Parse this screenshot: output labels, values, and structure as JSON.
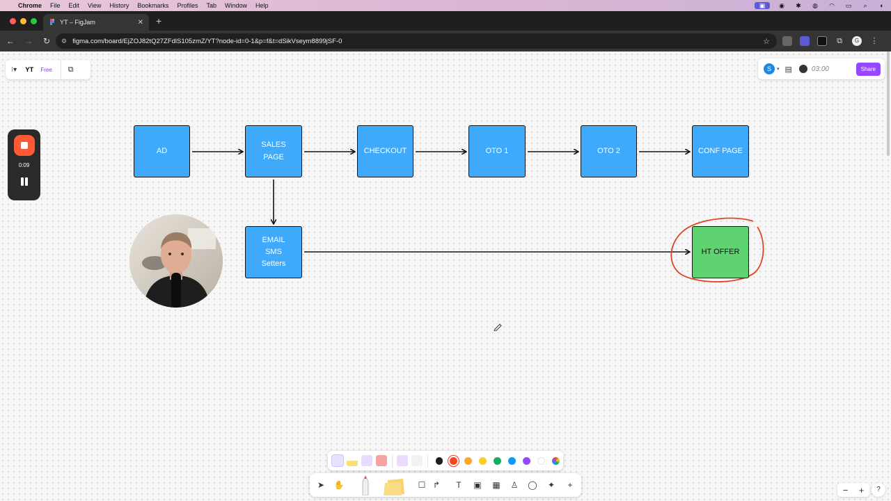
{
  "menubar": {
    "app_name": "Chrome",
    "items": [
      "File",
      "Edit",
      "View",
      "History",
      "Bookmarks",
      "Profiles",
      "Tab",
      "Window",
      "Help"
    ]
  },
  "browser": {
    "tab_title": "YT – FigJam",
    "url": "figma.com/board/EjZOJ82tQ27ZFdlS105zmZ/YT?node-id=0-1&p=f&t=dSikVseym8899jSF-0"
  },
  "file": {
    "name": "YT",
    "plan": "Free"
  },
  "header": {
    "avatar_initial": "S",
    "timer": "03:00",
    "share_label": "Share"
  },
  "recorder": {
    "elapsed": "0:09"
  },
  "flow": {
    "nodes": [
      {
        "id": "ad",
        "lines": [
          "AD"
        ]
      },
      {
        "id": "sales-page",
        "lines": [
          "SALES",
          "PAGE"
        ]
      },
      {
        "id": "checkout",
        "lines": [
          "CHECKOUT"
        ]
      },
      {
        "id": "oto-1",
        "lines": [
          "OTO 1"
        ]
      },
      {
        "id": "oto-2",
        "lines": [
          "OTO 2"
        ]
      },
      {
        "id": "conf-page",
        "lines": [
          "CONF PAGE"
        ]
      },
      {
        "id": "email-sms-setters",
        "lines": [
          "EMAIL",
          "SMS",
          "Setters"
        ]
      },
      {
        "id": "ht-offer",
        "lines": [
          "HT OFFER"
        ]
      }
    ],
    "connectors": [
      [
        "ad",
        "sales-page"
      ],
      [
        "sales-page",
        "checkout"
      ],
      [
        "checkout",
        "oto-1"
      ],
      [
        "oto-1",
        "oto-2"
      ],
      [
        "oto-2",
        "conf-page"
      ],
      [
        "sales-page",
        "email-sms-setters"
      ],
      [
        "email-sms-setters",
        "ht-offer"
      ]
    ],
    "colors": {
      "node_blue": "#3fa9fb",
      "node_green": "#5fd36f",
      "annotation_circle": "#e0451f"
    }
  },
  "palette": {
    "colors": [
      "#1e1e1e",
      "#f24822",
      "#ffa629",
      "#ffcd29",
      "#14ae5c",
      "#0d99ff",
      "#9747ff",
      "#ffffff"
    ],
    "selected_color": "#f24822"
  },
  "zoom": {
    "minus": "−",
    "plus": "+",
    "help": "?"
  }
}
